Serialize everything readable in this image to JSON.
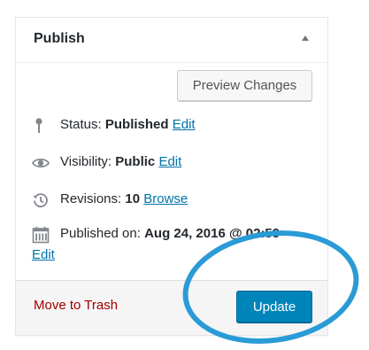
{
  "publish_box": {
    "title": "Publish",
    "preview_label": "Preview Changes",
    "status": {
      "label": "Status:",
      "value": "Published",
      "edit_label": "Edit",
      "icon": "pin-icon"
    },
    "visibility": {
      "label": "Visibility:",
      "value": "Public",
      "edit_label": "Edit",
      "icon": "eye-icon"
    },
    "revisions": {
      "label": "Revisions:",
      "value": "10",
      "link_label": "Browse",
      "icon": "history-icon"
    },
    "published_on": {
      "label": "Published on:",
      "value": "Aug 24, 2016 @ 02:59",
      "edit_label": "Edit",
      "icon": "calendar-icon"
    },
    "trash_label": "Move to Trash",
    "update_label": "Update"
  },
  "colors": {
    "link": "#0073aa",
    "trash": "#a00000",
    "primary_button": "#0085ba",
    "highlight_ring": "#2a9bd6"
  }
}
